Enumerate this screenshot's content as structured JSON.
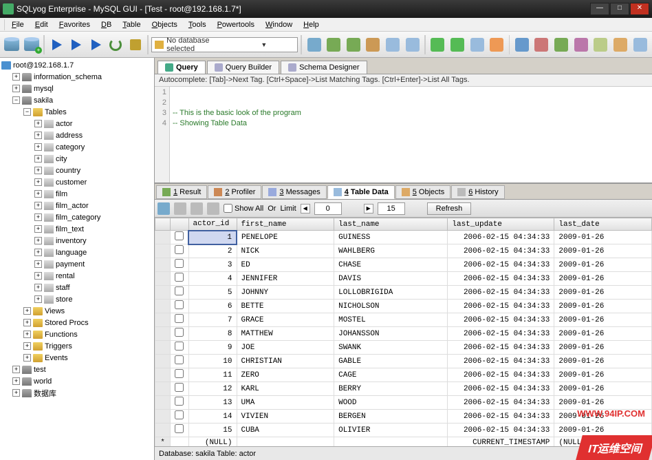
{
  "title": "SQLyog Enterprise - MySQL GUI - [Test - root@192.168.1.7*]",
  "menus": [
    "File",
    "Edit",
    "Favorites",
    "DB",
    "Table",
    "Objects",
    "Tools",
    "Powertools",
    "Window",
    "Help"
  ],
  "db_selector": "No database selected",
  "tree": {
    "root": "root@192.168.1.7",
    "schemas": [
      {
        "name": "information_schema",
        "expanded": false
      },
      {
        "name": "mysql",
        "expanded": false
      },
      {
        "name": "sakila",
        "expanded": true,
        "folders": [
          {
            "name": "Tables",
            "expanded": true,
            "tables": [
              "actor",
              "address",
              "category",
              "city",
              "country",
              "customer",
              "film",
              "film_actor",
              "film_category",
              "film_text",
              "inventory",
              "language",
              "payment",
              "rental",
              "staff",
              "store"
            ]
          },
          {
            "name": "Views",
            "expanded": false
          },
          {
            "name": "Stored Procs",
            "expanded": false
          },
          {
            "name": "Functions",
            "expanded": false
          },
          {
            "name": "Triggers",
            "expanded": false
          },
          {
            "name": "Events",
            "expanded": false
          }
        ]
      },
      {
        "name": "test",
        "expanded": false
      },
      {
        "name": "world",
        "expanded": false
      },
      {
        "name": "数据库",
        "expanded": false
      }
    ]
  },
  "query_tabs": [
    {
      "label": "Query",
      "active": true
    },
    {
      "label": "Query Builder",
      "active": false
    },
    {
      "label": "Schema Designer",
      "active": false
    }
  ],
  "autocomplete_hint": "Autocomplete: [Tab]->Next Tag. [Ctrl+Space]->List Matching Tags. [Ctrl+Enter]->List All Tags.",
  "editor": {
    "lines": [
      "",
      "",
      "-- This is the basic look of the program",
      "-- Showing Table Data"
    ]
  },
  "result_tabs": [
    {
      "label": "1 Result"
    },
    {
      "label": "2 Profiler"
    },
    {
      "label": "3 Messages"
    },
    {
      "label": "4 Table Data",
      "active": true
    },
    {
      "label": "5 Objects"
    },
    {
      "label": "6 History"
    }
  ],
  "result_toolbar": {
    "show_all": "Show All",
    "or": "Or",
    "limit": "Limit",
    "offset": "0",
    "count": "15",
    "refresh": "Refresh"
  },
  "grid": {
    "columns": [
      "actor_id",
      "first_name",
      "last_name",
      "last_update",
      "last_date"
    ],
    "rows": [
      {
        "actor_id": 1,
        "first_name": "PENELOPE",
        "last_name": "GUINESS",
        "last_update": "2006-02-15 04:34:33",
        "last_date": "2009-01-26"
      },
      {
        "actor_id": 2,
        "first_name": "NICK",
        "last_name": "WAHLBERG",
        "last_update": "2006-02-15 04:34:33",
        "last_date": "2009-01-26"
      },
      {
        "actor_id": 3,
        "first_name": "ED",
        "last_name": "CHASE",
        "last_update": "2006-02-15 04:34:33",
        "last_date": "2009-01-26"
      },
      {
        "actor_id": 4,
        "first_name": "JENNIFER",
        "last_name": "DAVIS",
        "last_update": "2006-02-15 04:34:33",
        "last_date": "2009-01-26"
      },
      {
        "actor_id": 5,
        "first_name": "JOHNNY",
        "last_name": "LOLLOBRIGIDA",
        "last_update": "2006-02-15 04:34:33",
        "last_date": "2009-01-26"
      },
      {
        "actor_id": 6,
        "first_name": "BETTE",
        "last_name": "NICHOLSON",
        "last_update": "2006-02-15 04:34:33",
        "last_date": "2009-01-26"
      },
      {
        "actor_id": 7,
        "first_name": "GRACE",
        "last_name": "MOSTEL",
        "last_update": "2006-02-15 04:34:33",
        "last_date": "2009-01-26"
      },
      {
        "actor_id": 8,
        "first_name": "MATTHEW",
        "last_name": "JOHANSSON",
        "last_update": "2006-02-15 04:34:33",
        "last_date": "2009-01-26"
      },
      {
        "actor_id": 9,
        "first_name": "JOE",
        "last_name": "SWANK",
        "last_update": "2006-02-15 04:34:33",
        "last_date": "2009-01-26"
      },
      {
        "actor_id": 10,
        "first_name": "CHRISTIAN",
        "last_name": "GABLE",
        "last_update": "2006-02-15 04:34:33",
        "last_date": "2009-01-26"
      },
      {
        "actor_id": 11,
        "first_name": "ZERO",
        "last_name": "CAGE",
        "last_update": "2006-02-15 04:34:33",
        "last_date": "2009-01-26"
      },
      {
        "actor_id": 12,
        "first_name": "KARL",
        "last_name": "BERRY",
        "last_update": "2006-02-15 04:34:33",
        "last_date": "2009-01-26"
      },
      {
        "actor_id": 13,
        "first_name": "UMA",
        "last_name": "WOOD",
        "last_update": "2006-02-15 04:34:33",
        "last_date": "2009-01-26"
      },
      {
        "actor_id": 14,
        "first_name": "VIVIEN",
        "last_name": "BERGEN",
        "last_update": "2006-02-15 04:34:33",
        "last_date": "2009-01-26"
      },
      {
        "actor_id": 15,
        "first_name": "CUBA",
        "last_name": "OLIVIER",
        "last_update": "2006-02-15 04:34:33",
        "last_date": "2009-01-26"
      }
    ],
    "null_row": {
      "actor_id": "(NULL)",
      "first_name": "",
      "last_name": "",
      "last_update": "CURRENT_TIMESTAMP",
      "last_date": "(NULL)"
    }
  },
  "status": "Database: sakila Table: actor",
  "watermark": {
    "text": "IT运维空间",
    "url": "WWW.94IP.COM"
  }
}
